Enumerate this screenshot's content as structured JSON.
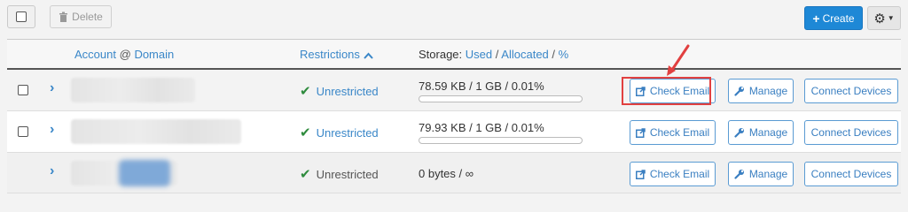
{
  "toolbar": {
    "delete_label": "Delete",
    "create_label": "Create"
  },
  "header": {
    "account": "Account",
    "at": "@",
    "domain": "Domain",
    "restrictions": "Restrictions",
    "storage_prefix": "Storage:",
    "used": "Used",
    "sep1": "/",
    "allocated": "Allocated",
    "sep2": "/",
    "percent": "%"
  },
  "rows": [
    {
      "restriction": "Unrestricted",
      "storage": "78.59 KB / 1 GB / 0.01%",
      "usage_fraction": 0.0001,
      "check_email": "Check Email",
      "manage": "Manage",
      "connect": "Connect Devices"
    },
    {
      "restriction": "Unrestricted",
      "storage": "79.93 KB / 1 GB / 0.01%",
      "usage_fraction": 0.0001,
      "check_email": "Check Email",
      "manage": "Manage",
      "connect": "Connect Devices"
    },
    {
      "restriction": "Unrestricted",
      "storage": "0 bytes / ∞",
      "check_email": "Check Email",
      "manage": "Manage",
      "connect": "Connect Devices"
    }
  ],
  "colors": {
    "primary": "#1e88d6",
    "link": "#3a87c8",
    "success": "#2e8b3d",
    "annotation": "#e14040"
  },
  "icons": [
    "trash-icon",
    "plus-icon",
    "gear-icon",
    "caret-down-icon",
    "caret-up-icon",
    "chevron-right-icon",
    "check-icon",
    "external-link-icon",
    "wrench-icon",
    "arrow-annotation-icon"
  ]
}
